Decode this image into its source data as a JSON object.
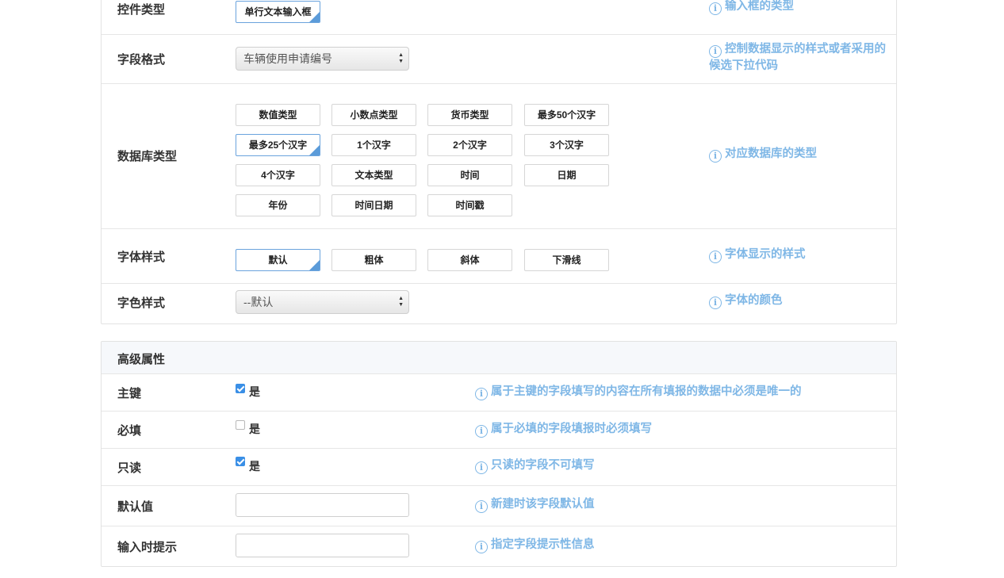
{
  "basic": {
    "control_type": {
      "label": "控件类型",
      "value": "单行文本输入框",
      "hint": "输入框的类型"
    },
    "field_format": {
      "label": "字段格式",
      "value": "车辆使用申请编号",
      "hint_line1": "控制数据显示的样式或者采用的",
      "hint_line2": "候选下拉代码"
    },
    "db_type": {
      "label": "数据库类型",
      "options": [
        "数值类型",
        "小数点类型",
        "货币类型",
        "最多50个汉字",
        "最多25个汉字",
        "1个汉字",
        "2个汉字",
        "3个汉字",
        "4个汉字",
        "文本类型",
        "时间",
        "日期",
        "年份",
        "时间日期",
        "时间戳"
      ],
      "selected": "最多25个汉字",
      "hint": "对应数据库的类型"
    },
    "font_style": {
      "label": "字体样式",
      "options": [
        "默认",
        "粗体",
        "斜体",
        "下滑线"
      ],
      "selected": "默认",
      "hint": "字体显示的样式"
    },
    "font_color": {
      "label": "字色样式",
      "value": "--默认",
      "hint": "字体的颜色"
    }
  },
  "advanced": {
    "title": "高级属性",
    "primary_key": {
      "label": "主键",
      "checked": true,
      "check_label": "是",
      "hint": "属于主键的字段填写的内容在所有填报的数据中必须是唯一的"
    },
    "required": {
      "label": "必填",
      "checked": false,
      "check_label": "是",
      "hint": "属于必填的字段填报时必须填写"
    },
    "readonly": {
      "label": "只读",
      "checked": true,
      "check_label": "是",
      "hint": "只读的字段不可填写"
    },
    "default_value": {
      "label": "默认值",
      "value": "",
      "hint": "新建时该字段默认值"
    },
    "input_tip": {
      "label": "输入时提示",
      "value": "",
      "hint": "指定字段提示性信息"
    }
  },
  "colors": {
    "hint": "#7fb7e6",
    "accent": "#3a8fe6",
    "selected_corner": "#5b9bd9"
  },
  "icons": {
    "info": "info-circle-icon",
    "select_arrows": "updown-arrows-icon",
    "checkbox": "checkbox-icon"
  }
}
